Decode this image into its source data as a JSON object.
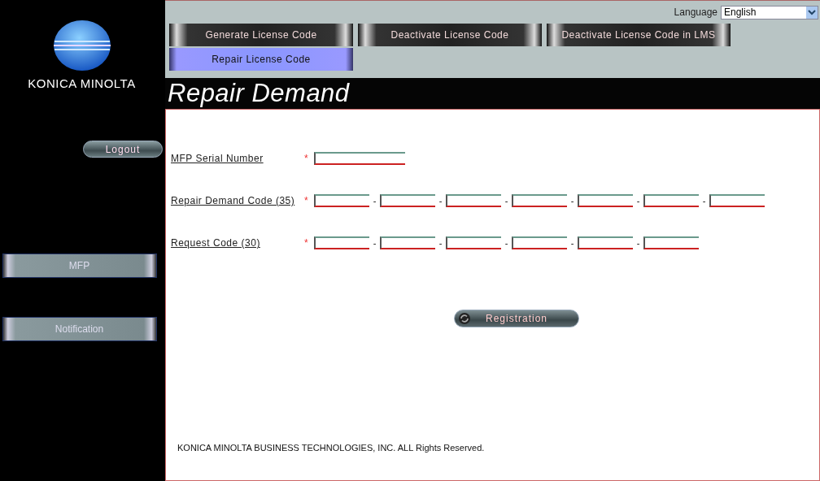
{
  "sidebar": {
    "logo_text": "KONICA MINOLTA",
    "logout": "Logout",
    "items": [
      {
        "label": "MFP"
      },
      {
        "label": "Notification"
      }
    ]
  },
  "language": {
    "label": "Language",
    "value": "English"
  },
  "tabs": [
    {
      "label": "Generate License Code",
      "selected": false
    },
    {
      "label": "Deactivate License Code",
      "selected": false
    },
    {
      "label": "Deactivate License Code in LMS",
      "selected": false
    },
    {
      "label": "Repair License Code",
      "selected": true
    }
  ],
  "page_title": "Repair Demand",
  "form": [
    {
      "label": "MFP Serial Number",
      "required": "*",
      "inputs": [
        {
          "kind": "wide"
        }
      ]
    },
    {
      "label": "Repair Demand Code (35)",
      "required": "*",
      "separator": "-",
      "inputs": [
        {
          "kind": "part"
        },
        {
          "kind": "part"
        },
        {
          "kind": "part"
        },
        {
          "kind": "part"
        },
        {
          "kind": "part"
        },
        {
          "kind": "part"
        },
        {
          "kind": "part"
        }
      ]
    },
    {
      "label": "Request Code (30)",
      "required": "*",
      "separator": "-",
      "inputs": [
        {
          "kind": "part"
        },
        {
          "kind": "part"
        },
        {
          "kind": "part"
        },
        {
          "kind": "part"
        },
        {
          "kind": "part"
        },
        {
          "kind": "part"
        }
      ]
    }
  ],
  "submit": "Registration",
  "footer": "KONICA MINOLTA BUSINESS TECHNOLOGIES, INC. ALL Rights Reserved."
}
